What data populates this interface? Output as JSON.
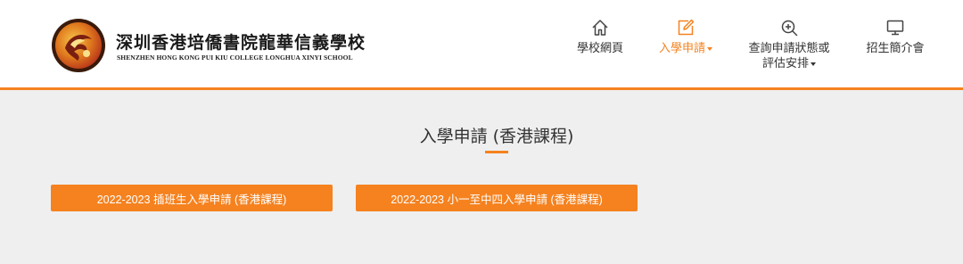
{
  "brand": {
    "name_cn": "深圳香港培僑書院龍華信義學校",
    "name_en": "SHENZHEN HONG KONG PUI KIU COLLEGE LONGHUA XINYI SCHOOL"
  },
  "nav": {
    "home": {
      "label": "學校網頁",
      "icon": "home-icon"
    },
    "apply": {
      "label": "入學申請",
      "icon": "edit-icon"
    },
    "status": {
      "line1": "查詢申請狀態或",
      "line2": "評估安排",
      "icon": "zoom-in-icon"
    },
    "intro": {
      "label": "招生簡介會",
      "icon": "monitor-icon"
    }
  },
  "main": {
    "title": "入學申請 (香港課程)",
    "buttons": [
      {
        "label": "2022-2023 插班生入學申請 (香港課程)"
      },
      {
        "label": "2022-2023 小一至中四入學申請 (香港課程)"
      }
    ]
  },
  "colors": {
    "accent": "#f5821f",
    "background": "#efefef",
    "header": "#ffffff"
  }
}
